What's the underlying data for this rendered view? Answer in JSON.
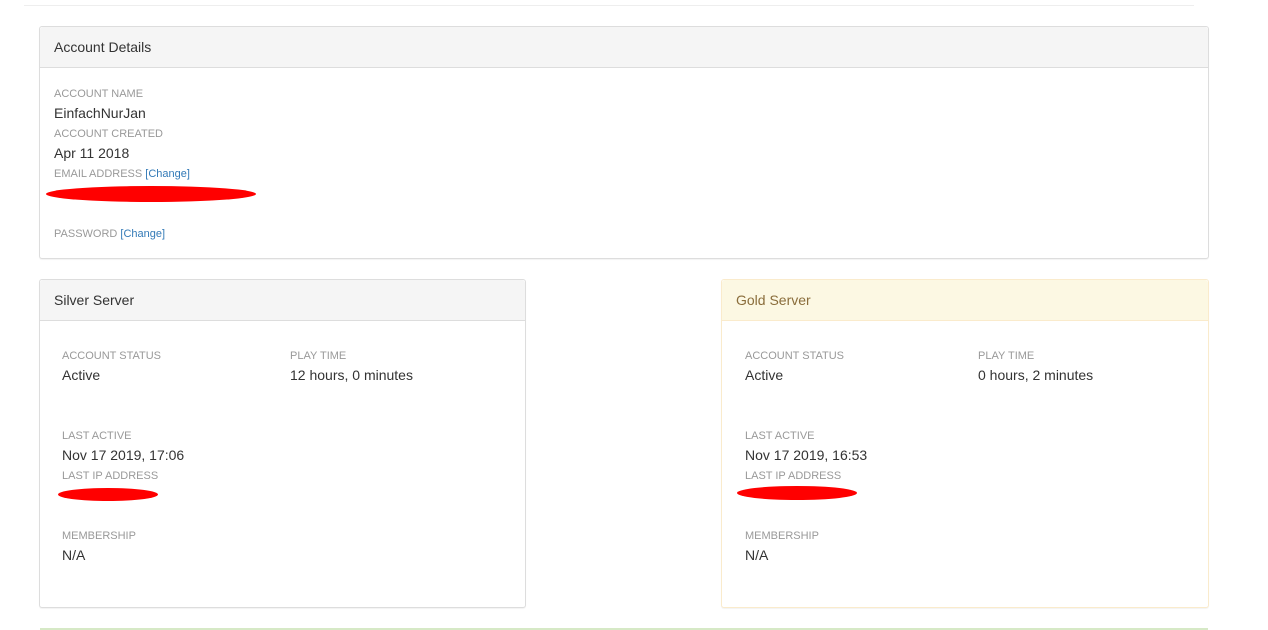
{
  "account_details": {
    "heading": "Account Details",
    "account_name_label": "ACCOUNT NAME",
    "account_name": "EinfachNurJan",
    "account_created_label": "ACCOUNT CREATED",
    "account_created": "Apr 11 2018",
    "email_label": "EMAIL ADDRESS",
    "email_change": "[Change]",
    "password_label": "PASSWORD",
    "password_change": "[Change]"
  },
  "silver_server": {
    "heading": "Silver Server",
    "status_label": "ACCOUNT STATUS",
    "status": "Active",
    "play_time_label": "PLAY TIME",
    "play_time": "12 hours, 0 minutes",
    "last_active_label": "LAST ACTIVE",
    "last_active": "Nov 17 2019, 17:06",
    "last_ip_label": "LAST IP ADDRESS",
    "membership_label": "MEMBERSHIP",
    "membership": "N/A"
  },
  "gold_server": {
    "heading": "Gold Server",
    "status_label": "ACCOUNT STATUS",
    "status": "Active",
    "play_time_label": "PLAY TIME",
    "play_time": "0 hours, 2 minutes",
    "last_active_label": "LAST ACTIVE",
    "last_active": "Nov 17 2019, 16:53",
    "last_ip_label": "LAST IP ADDRESS",
    "membership_label": "MEMBERSHIP",
    "membership": "N/A"
  },
  "colors": {
    "redaction": "#ff0000",
    "link": "#337ab7",
    "label": "#999999",
    "warning_heading_bg": "#fcf8e3"
  }
}
